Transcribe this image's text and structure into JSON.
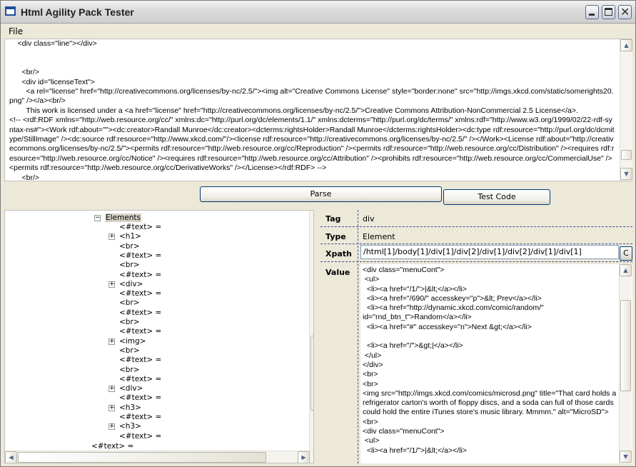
{
  "window": {
    "title": "Html Agility Pack Tester"
  },
  "menu": {
    "file": "File"
  },
  "source": {
    "text": "    <div class=\"line\"></div>\n\n\n      <br/>\n      <div id=\"licenseText\">\n        <a rel=\"license\" href=\"http://creativecommons.org/licenses/by-nc/2.5/\"><img alt=\"Creative Commons License\" style=\"border:none\" src=\"http://imgs.xkcd.com/static/somerights20.png\" /></a><br/>\n        This work is licensed under a <a href=\"license\" href=\"http://creativecommons.org/licenses/by-nc/2.5/\">Creative Commons Attribution-NonCommercial 2.5 License</a>.\n<!-- <rdf:RDF xmlns=\"http://web.resource.org/cc/\" xmlns:dc=\"http://purl.org/dc/elements/1.1/\" xmlns:dcterms=\"http://purl.org/dc/terms/\" xmlns:rdf=\"http://www.w3.org/1999/02/22-rdf-syntax-ns#\"><Work rdf:about=\"\"><dc:creator>Randall Munroe</dc:creator><dcterms:rightsHolder>Randall Munroe</dcterms:rightsHolder><dc:type rdf:resource=\"http://purl.org/dc/dcmitype/StillImage\" /><dc:source rdf:resource=\"http://www.xkcd.com/\"/><license rdf:resource=\"http://creativecommons.org/licenses/by-nc/2.5/\" /></Work><License rdf:about=\"http://creativecommons.org/licenses/by-nc/2.5/\"><permits rdf:resource=\"http://web.resource.org/cc/Reproduction\" /><permits rdf:resource=\"http://web.resource.org/cc/Distribution\" /><requires rdf:resource=\"http://web.resource.org/cc/Notice\" /><requires rdf:resource=\"http://web.resource.org/cc/Attribution\" /><prohibits rdf:resource=\"http://web.resource.org/cc/CommercialUse\" /><permits rdf:resource=\"http://web.resource.org/cc/DerivativeWorks\" /></License></rdf:RDF> -->\n      <br/>"
  },
  "buttons": {
    "parse": "Parse",
    "test_code": "Test Code",
    "copy": "C"
  },
  "tree": {
    "root_label": "Elements",
    "nodes": [
      "<#text> =",
      "<h1>",
      "<br>",
      "<#text> =",
      "<br>",
      "<#text> =",
      "<div>",
      "<#text> =",
      "<br>",
      "<#text> =",
      "<br>",
      "<#text> =",
      "<img>",
      "<br>",
      "<#text> =",
      "<br>",
      "<#text> =",
      "<div>",
      "<#text> =",
      "<h3>",
      "<#text> =",
      "<h3>",
      "<#text> ="
    ],
    "last_node": "<#text> ="
  },
  "properties": {
    "tag_label": "Tag",
    "tag_value": "div",
    "type_label": "Type",
    "type_value": "Element",
    "xpath_label": "Xpath",
    "xpath_value": "/html[1]/body[1]/div[1]/div[2]/div[1]/div[2]/div[1]/div[1]",
    "value_label": "Value",
    "value_text": "<div class=\"menuCont\">\n <ul>\n  <li><a href=\"/1/\">|&lt;</a></li>\n  <li><a href=\"/690/\" accesskey=\"p\">&lt; Prev</a></li>\n  <li><a href=\"http://dynamic.xkcd.com/comic/random/\" id=\"rnd_btn_t\">Random</a></li>\n  <li><a href=\"#\" accesskey=\"n\">Next &gt;</a></li>\n\n  <li><a href=\"/\">&gt;|</a></li>\n </ul>\n</div>\n<br>\n<br>\n<img src=\"http://imgs.xkcd.com/comics/microsd.png\" title=\"That card holds a refrigerator carton's worth of floppy discs, and a soda can full of those cards could hold the entire iTunes store's music library. Mmmm.\" alt=\"MicroSD\">\n<br>\n<div class=\"menuCont\">\n <ul>\n  <li><a href=\"/1/\">|&lt;</a></li>"
  }
}
